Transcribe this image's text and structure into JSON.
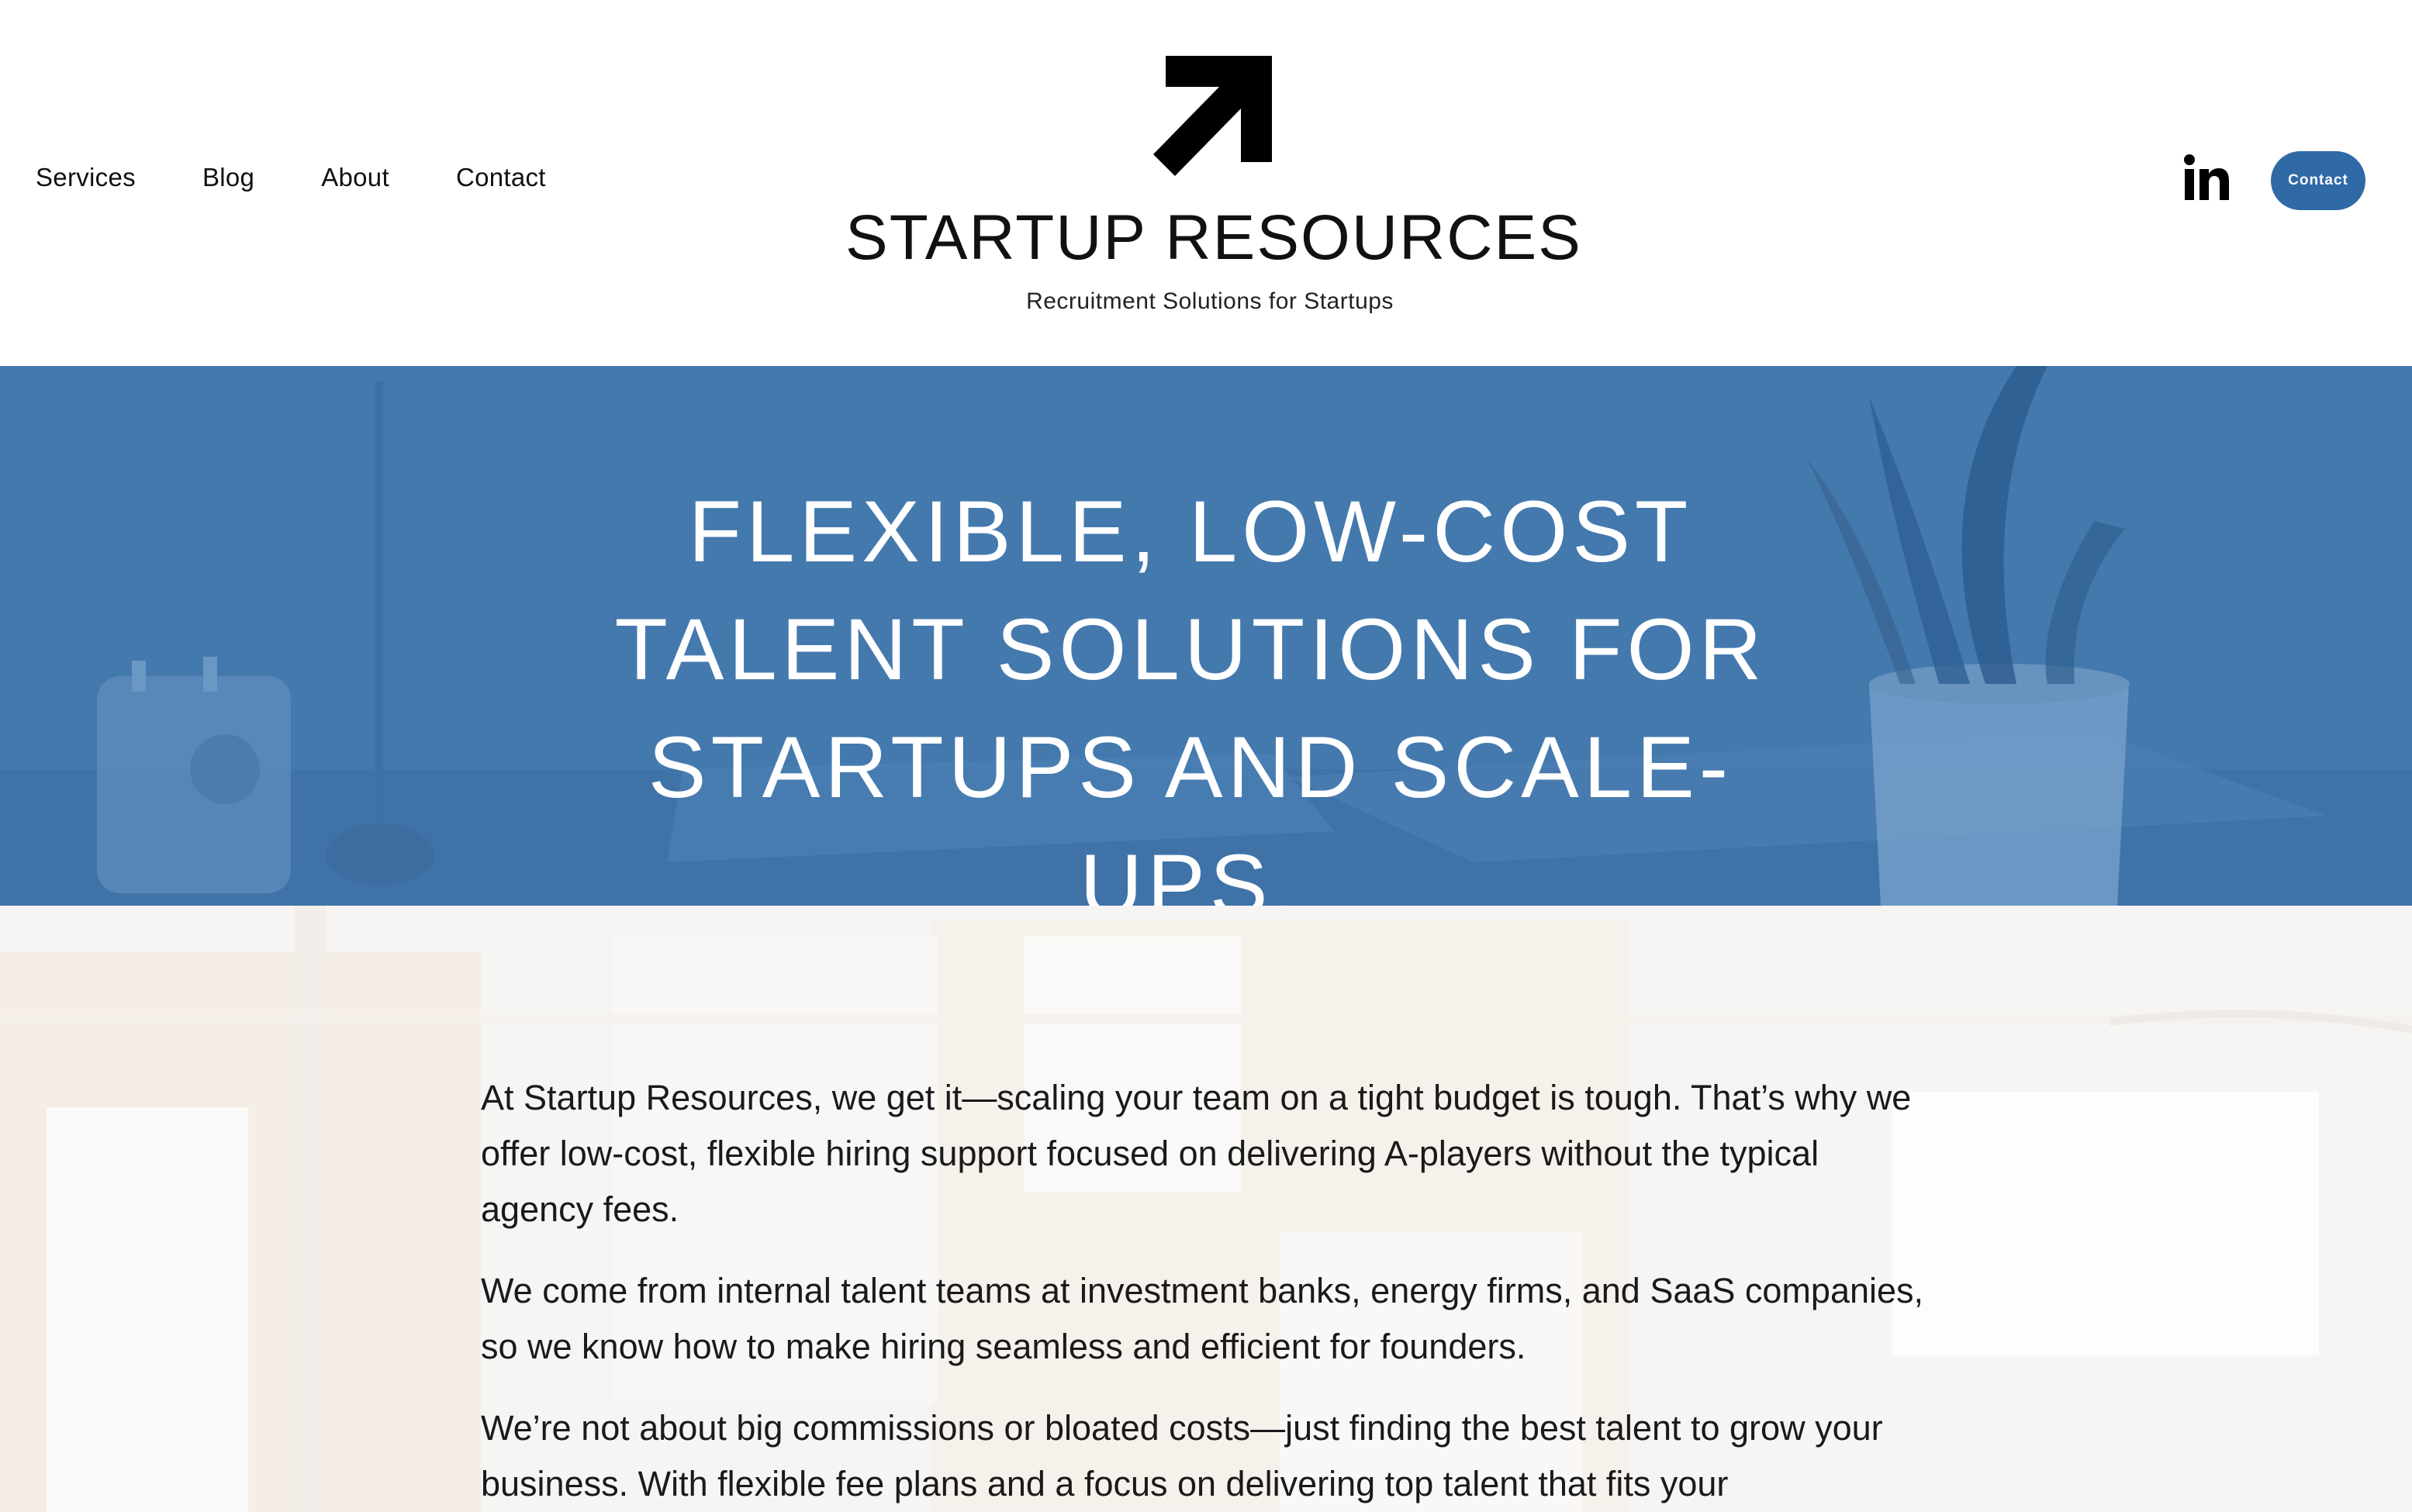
{
  "nav": {
    "items": [
      {
        "label": "Services"
      },
      {
        "label": "Blog"
      },
      {
        "label": "About"
      },
      {
        "label": "Contact"
      }
    ]
  },
  "logo": {
    "title": "STARTUP RESOURCES",
    "tagline": "Recruitment Solutions for Startups",
    "icon": "arrow-up-right-icon"
  },
  "social": {
    "icon": "linkedin-icon"
  },
  "header_button": {
    "label": "Contact"
  },
  "hero": {
    "heading": "FLEXIBLE, LOW-COST TALENT SOLUTIONS FOR STARTUPS AND SCALE-UPS."
  },
  "intro": {
    "paragraphs": [
      "At Startup Resources, we get it—scaling your team on a tight budget is tough. That’s why we offer low-cost, flexible hiring support focused on delivering A-players without the typical agency fees.",
      "We come from internal talent teams at investment banks, energy firms, and SaaS companies, so we know how to make hiring seamless and efficient for founders.",
      "We’re not about big commissions or bloated costs—just finding the best talent to grow your business. With flexible fee plans and a focus on delivering top talent that fits your"
    ]
  },
  "colors": {
    "accent": "#2f6aa6",
    "hero_overlay": "#4479ae",
    "text": "#111111"
  }
}
